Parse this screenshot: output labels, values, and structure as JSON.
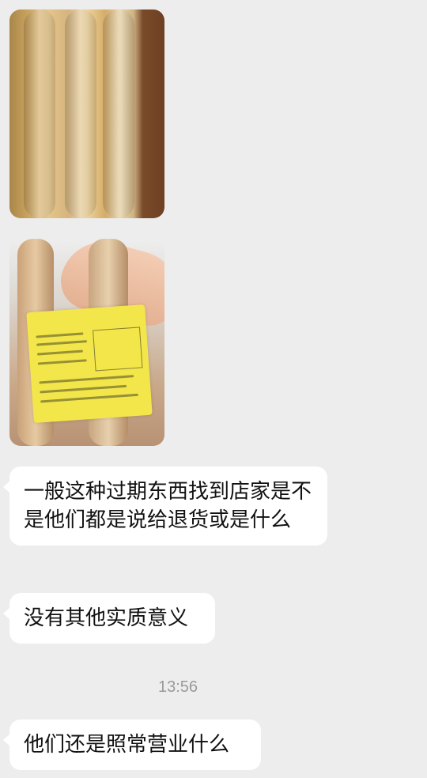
{
  "messages": [
    {
      "type": "image",
      "description_icon": "photo-bread-package-front"
    },
    {
      "type": "image",
      "description_icon": "photo-bread-package-label"
    },
    {
      "type": "text",
      "text": "一般这种过期东西找到店家是不是他们都是说给退货或是什么"
    },
    {
      "type": "text",
      "text": "没有其他实质意义"
    },
    {
      "type": "text",
      "text": "他们还是照常营业什么"
    }
  ],
  "timestamp": "13:56",
  "colors": {
    "background": "#ededed",
    "bubble": "#ffffff",
    "text": "#111111",
    "timestamp": "#9a9a9a"
  }
}
